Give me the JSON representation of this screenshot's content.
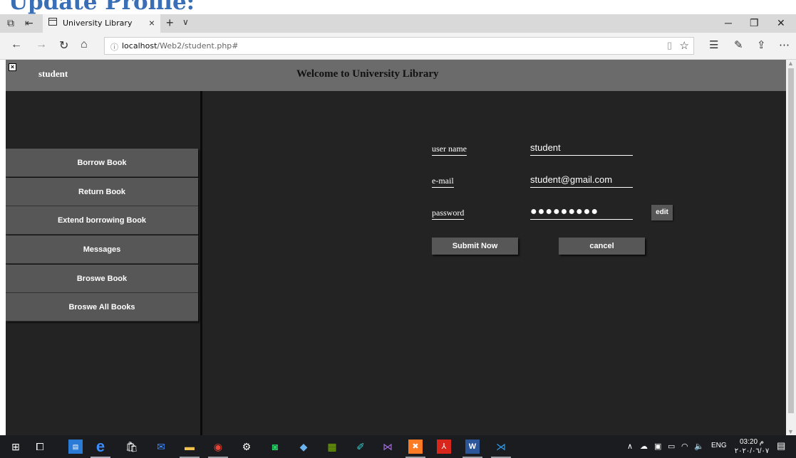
{
  "page": {
    "heading": "Update Profile:"
  },
  "browser": {
    "tab_title": "University Library",
    "tab_close": "×",
    "new_tab": "+",
    "url_host": "localhost",
    "url_path": "/Web2/student.php#"
  },
  "site": {
    "header_user": "student",
    "header_title": "Welcome to University Library"
  },
  "sidebar": {
    "items": [
      {
        "label": "Borrow Book"
      },
      {
        "label": "Return Book"
      },
      {
        "label": "Extend borrowing Book"
      },
      {
        "label": "Messages"
      },
      {
        "label": "Broswe Book"
      },
      {
        "label": "Broswe All Books"
      }
    ]
  },
  "form": {
    "username_label": "user name",
    "username_value": "student",
    "email_label": "e-mail",
    "email_value": "student@gmail.com",
    "password_label": "password",
    "password_value": "●●●●●●●●●",
    "edit_label": "edit",
    "submit_label": "Submit Now",
    "cancel_label": "cancel"
  },
  "taskbar": {
    "language": "ENG",
    "time": "03:20 م",
    "date": "٢٠٢٠/٠٦/٠٧"
  },
  "colors": {
    "header_bg": "#6b6b6b",
    "content_bg": "#232323",
    "button_bg": "#575757",
    "heading_blue": "#3a6fb5"
  }
}
